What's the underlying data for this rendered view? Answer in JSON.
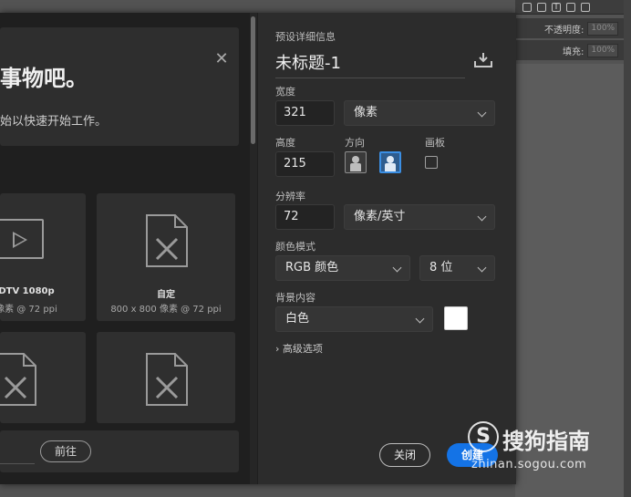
{
  "background_app": {
    "opacity_label": "不透明度:",
    "opacity_value": "100%",
    "fill_label": "填充:",
    "fill_value": "100%"
  },
  "left_pane": {
    "welcome_title": "事物吧。",
    "welcome_subtitle": "始以快速开始工作。",
    "tiles": [
      {
        "name": "DTV 1080p",
        "meta": "80 像素 @ 72 ppi"
      },
      {
        "name": "自定",
        "meta": "800 x 800 像素 @ 72 ppi"
      }
    ],
    "prev_label": "前往"
  },
  "right_pane": {
    "preset_details_label": "预设详细信息",
    "document_name": "未标题-1",
    "width_label": "宽度",
    "width_value": "321",
    "width_unit": "像素",
    "height_label": "高度",
    "height_value": "215",
    "orientation_label": "方向",
    "artboard_label": "画板",
    "resolution_label": "分辨率",
    "resolution_value": "72",
    "resolution_unit": "像素/英寸",
    "color_mode_label": "颜色模式",
    "color_mode_value": "RGB 颜色",
    "bit_depth_value": "8 位",
    "background_label": "背景内容",
    "background_value": "白色",
    "advanced_label": "高级选项",
    "close_label": "关闭",
    "create_label": "创建"
  },
  "watermark": {
    "logo": "S",
    "text": "搜狗指南",
    "url": "zhinan.sogou.com"
  },
  "colors": {
    "accent": "#1473e6",
    "swatch": "#ffffff"
  }
}
